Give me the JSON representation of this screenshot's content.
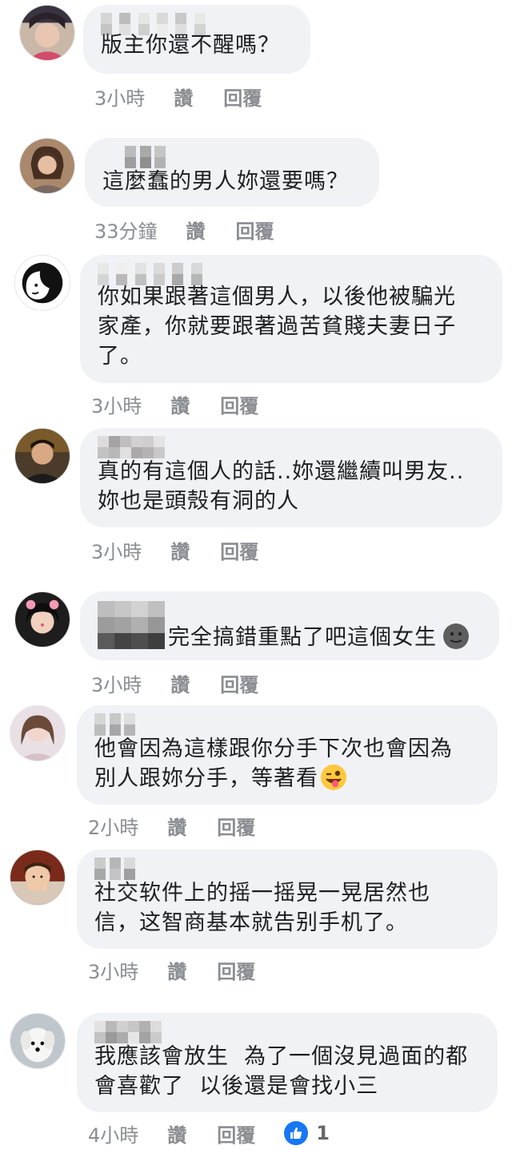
{
  "comments": [
    {
      "text": "版主你還不醒嗎？",
      "time": "3小時",
      "like": "讚",
      "reply": "回覆"
    },
    {
      "text": "這麼蠢的男人妳還要嗎？",
      "time": "33分鐘",
      "like": "讚",
      "reply": "回覆"
    },
    {
      "text": "你如果跟著這個男人，以後他被騙光\n家產，你就要跟著過苦貧賤夫妻日子\n了。",
      "time": "3小時",
      "like": "讚",
      "reply": "回覆"
    },
    {
      "text": "真的有這個人的話..妳還繼續叫男友..\n妳也是頭殼有洞的人",
      "time": "3小時",
      "like": "讚",
      "reply": "回覆"
    },
    {
      "text": "完全搞錯重點了吧這個女生",
      "time": "3小時",
      "like": "讚",
      "reply": "回覆",
      "emoji": "neutral-face-icon"
    },
    {
      "text": "他會因為這樣跟你分手下次也會因為\n別人跟妳分手，等著看",
      "time": "2小時",
      "like": "讚",
      "reply": "回覆",
      "emoji": "winking-tongue-face-icon"
    },
    {
      "text": "社交软件上的摇一摇晃一晃居然也\n信，这智商基本就告别手机了。",
      "time": "3小時",
      "like": "讚",
      "reply": "回覆"
    },
    {
      "text": "我應該會放生  為了一個沒見過面的都\n會喜歡了  以後還是會找小三",
      "time": "4小時",
      "like": "讚",
      "reply": "回覆",
      "reaction_count": "1",
      "reaction_icon": "like-thumb-icon"
    }
  ],
  "colors": {
    "bubble": "#f0f2f5",
    "meta": "#8a8d91",
    "like_blue": "#1877f2"
  }
}
